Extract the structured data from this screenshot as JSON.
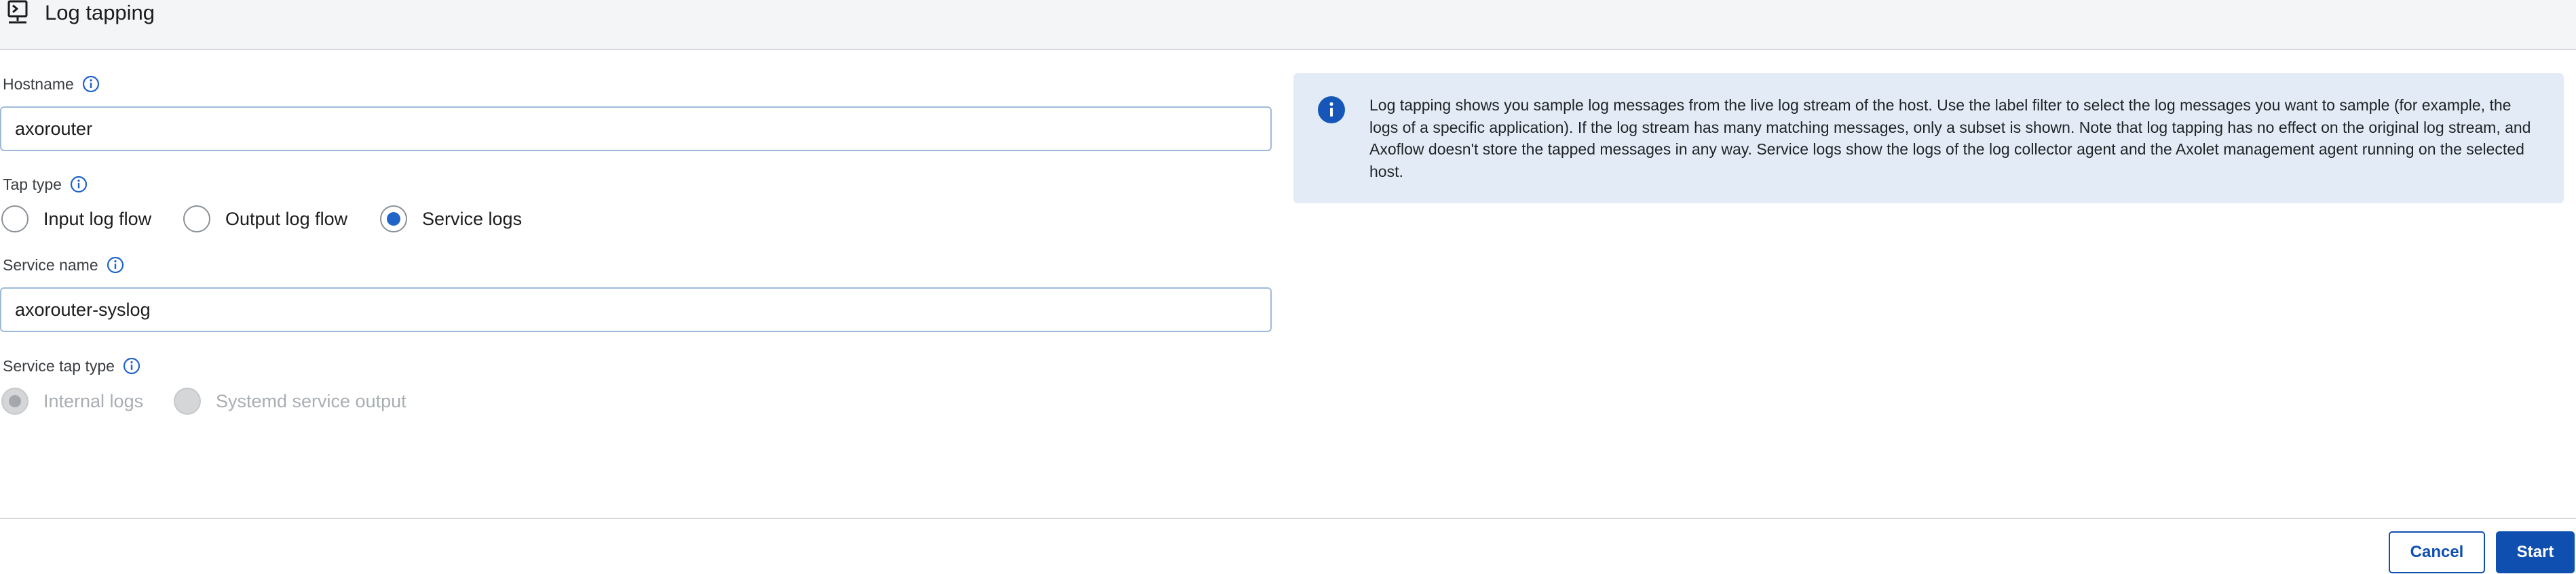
{
  "header": {
    "title": "Log tapping",
    "icon": "terminal-host-icon"
  },
  "form": {
    "hostname": {
      "label": "Hostname",
      "value": "axorouter",
      "info_icon": "info-outline-icon"
    },
    "tap_type": {
      "label": "Tap type",
      "info_icon": "info-outline-icon",
      "options": [
        {
          "label": "Input log flow",
          "checked": false
        },
        {
          "label": "Output log flow",
          "checked": false
        },
        {
          "label": "Service logs",
          "checked": true
        }
      ]
    },
    "service_name": {
      "label": "Service name",
      "value": "axorouter-syslog",
      "info_icon": "info-outline-icon"
    },
    "service_tap_type": {
      "label": "Service tap type",
      "info_icon": "info-outline-icon",
      "disabled": true,
      "options": [
        {
          "label": "Internal logs",
          "checked": true
        },
        {
          "label": "Systemd service output",
          "checked": false
        }
      ]
    }
  },
  "info_panel": {
    "icon": "info-filled-icon",
    "text": "Log tapping shows you sample log messages from the live log stream of the host. Use the label filter to select the log messages you want to sample (for example, the logs of a specific application). If the log stream has many matching messages, only a subset is shown. Note that log tapping has no effect on the original log stream, and Axoflow doesn't store the tapped messages in any way. Service logs show the logs of the log collector agent and the Axolet management agent running on the selected host."
  },
  "footer": {
    "cancel_label": "Cancel",
    "start_label": "Start"
  },
  "colors": {
    "accent": "#0f4fb0",
    "radio_selected": "#1f64c8",
    "info_panel_bg": "#e3ecf6",
    "header_bg": "#f4f5f6"
  }
}
